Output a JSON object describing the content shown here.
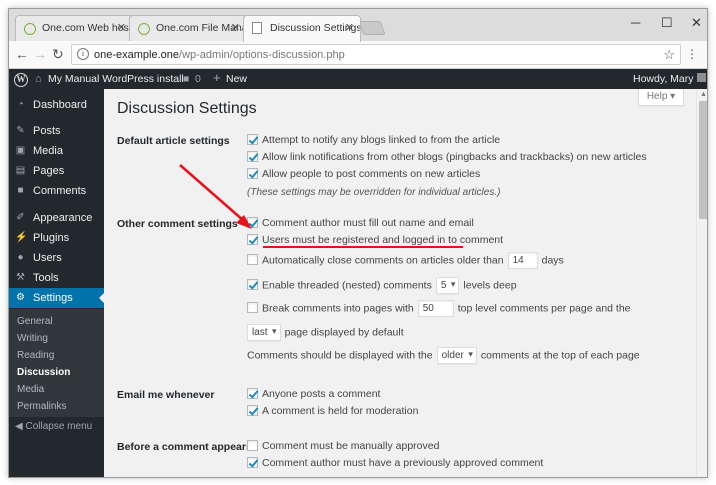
{
  "browser": {
    "tabs": [
      {
        "title": "One.com Web hosting"
      },
      {
        "title": "One.com File Manager"
      },
      {
        "title": "Discussion Settings ‹ My"
      }
    ],
    "url_host": "one-example.one",
    "url_path": "/wp-admin/options-discussion.php",
    "window_controls": {
      "minimize": "─",
      "maximize": "☐",
      "close": "✕"
    }
  },
  "adminbar": {
    "site_name": "My Manual WordPress install",
    "comments_count": "0",
    "new_label": "New",
    "greeting": "Howdy, Mary"
  },
  "sidebar": {
    "items": [
      {
        "label": "Dashboard",
        "icon": "dashboard-icon"
      },
      {
        "label": "Posts",
        "icon": "pin-icon"
      },
      {
        "label": "Media",
        "icon": "media-icon"
      },
      {
        "label": "Pages",
        "icon": "page-icon"
      },
      {
        "label": "Comments",
        "icon": "comment-icon"
      },
      {
        "label": "Appearance",
        "icon": "brush-icon"
      },
      {
        "label": "Plugins",
        "icon": "plugin-icon"
      },
      {
        "label": "Users",
        "icon": "users-icon"
      },
      {
        "label": "Tools",
        "icon": "wrench-icon"
      },
      {
        "label": "Settings",
        "icon": "settings-icon"
      }
    ],
    "submenu": [
      "General",
      "Writing",
      "Reading",
      "Discussion",
      "Media",
      "Permalinks"
    ],
    "collapse_label": "Collapse menu"
  },
  "page": {
    "title": "Discussion Settings",
    "help_label": "Help ▾",
    "sections": {
      "default_article": {
        "label": "Default article settings",
        "opt1": "Attempt to notify any blogs linked to from the article",
        "opt2": "Allow link notifications from other blogs (pingbacks and trackbacks) on new articles",
        "opt3": "Allow people to post comments on new articles",
        "note": "(These settings may be overridden for individual articles.)"
      },
      "other_comment": {
        "label": "Other comment settings",
        "opt1": "Comment author must fill out name and email",
        "opt2": "Users must be registered and logged in to comment",
        "opt3_pre": "Automatically close comments on articles older than",
        "opt3_value": "14",
        "opt3_post": "days",
        "opt4_pre": "Enable threaded (nested) comments",
        "opt4_value": "5",
        "opt4_post": "levels deep",
        "opt5_pre": "Break comments into pages with",
        "opt5_value": "50",
        "opt5_post": "top level comments per page and the",
        "opt6_value": "last",
        "opt6_post": "page displayed by default",
        "opt7_pre": "Comments should be displayed with the",
        "opt7_value": "older",
        "opt7_post": "comments at the top of each page"
      },
      "email_me": {
        "label": "Email me whenever",
        "opt1": "Anyone posts a comment",
        "opt2": "A comment is held for moderation"
      },
      "before_comment": {
        "label": "Before a comment appears",
        "opt1": "Comment must be manually approved",
        "opt2": "Comment author must have a previously approved comment"
      }
    }
  },
  "colors": {
    "admin_dark": "#23282d",
    "accent": "#0073aa",
    "annotation_red": "#e8111b"
  }
}
